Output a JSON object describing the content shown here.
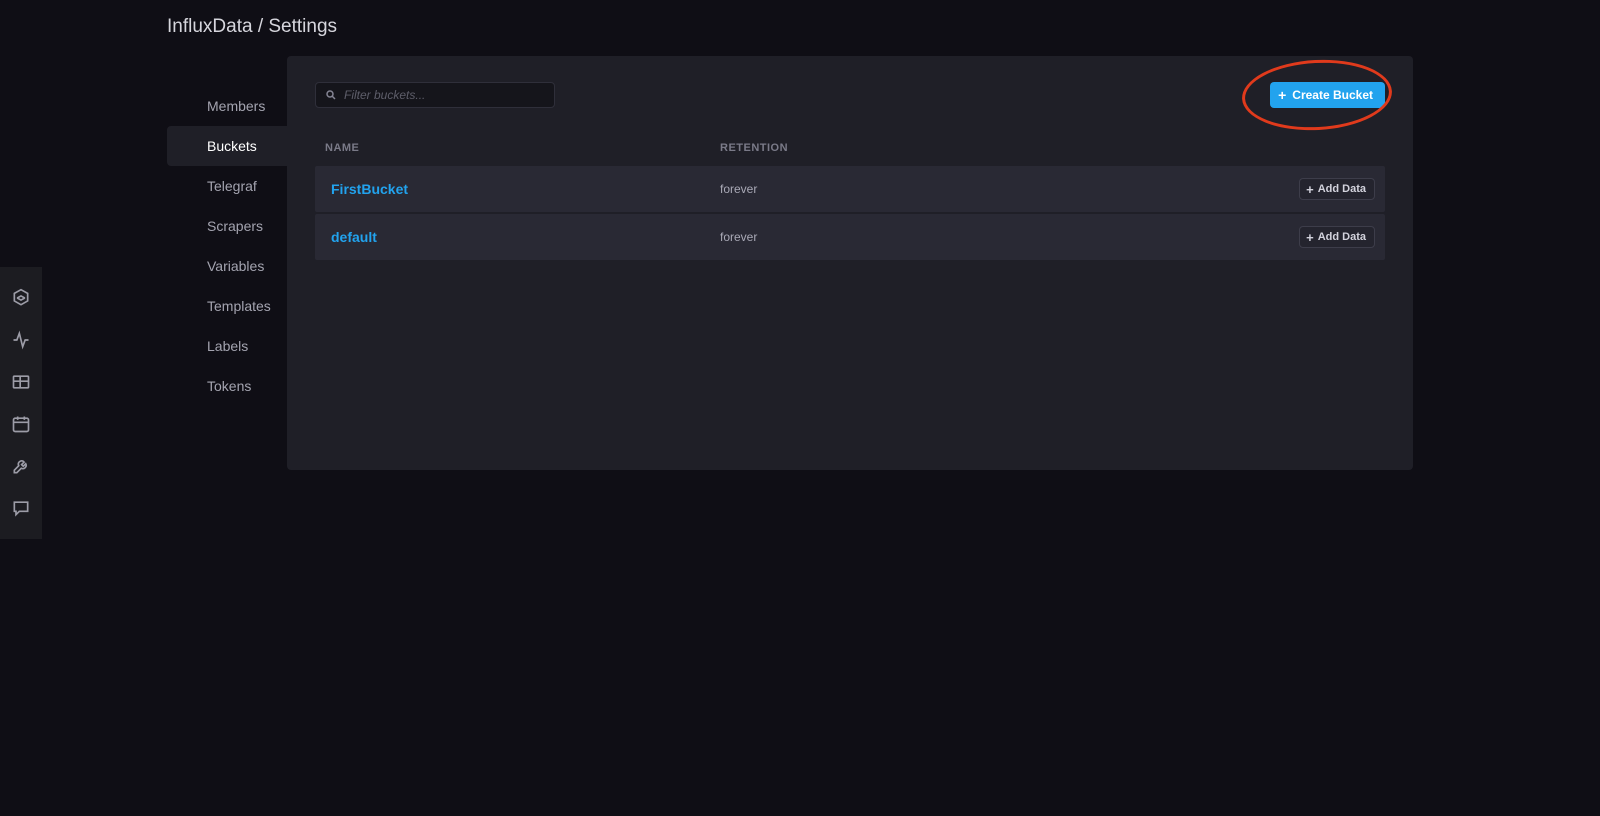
{
  "breadcrumb": "InfluxData / Settings",
  "sidebar": {
    "items": [
      {
        "id": "members",
        "label": "Members",
        "active": false
      },
      {
        "id": "buckets",
        "label": "Buckets",
        "active": true
      },
      {
        "id": "telegraf",
        "label": "Telegraf",
        "active": false
      },
      {
        "id": "scrapers",
        "label": "Scrapers",
        "active": false
      },
      {
        "id": "variables",
        "label": "Variables",
        "active": false
      },
      {
        "id": "templates",
        "label": "Templates",
        "active": false
      },
      {
        "id": "labels",
        "label": "Labels",
        "active": false
      },
      {
        "id": "tokens",
        "label": "Tokens",
        "active": false
      }
    ]
  },
  "search": {
    "placeholder": "Filter buckets..."
  },
  "create_button": {
    "label": "Create Bucket"
  },
  "table": {
    "headers": {
      "name": "NAME",
      "retention": "RETENTION"
    },
    "add_data_label": "Add Data",
    "rows": [
      {
        "name": "FirstBucket",
        "retention": "forever"
      },
      {
        "name": "default",
        "retention": "forever"
      }
    ]
  },
  "nav_icons": [
    {
      "id": "hex-icon"
    },
    {
      "id": "activity-icon"
    },
    {
      "id": "grid-icon"
    },
    {
      "id": "calendar-icon"
    },
    {
      "id": "wrench-icon"
    },
    {
      "id": "chat-icon"
    }
  ]
}
